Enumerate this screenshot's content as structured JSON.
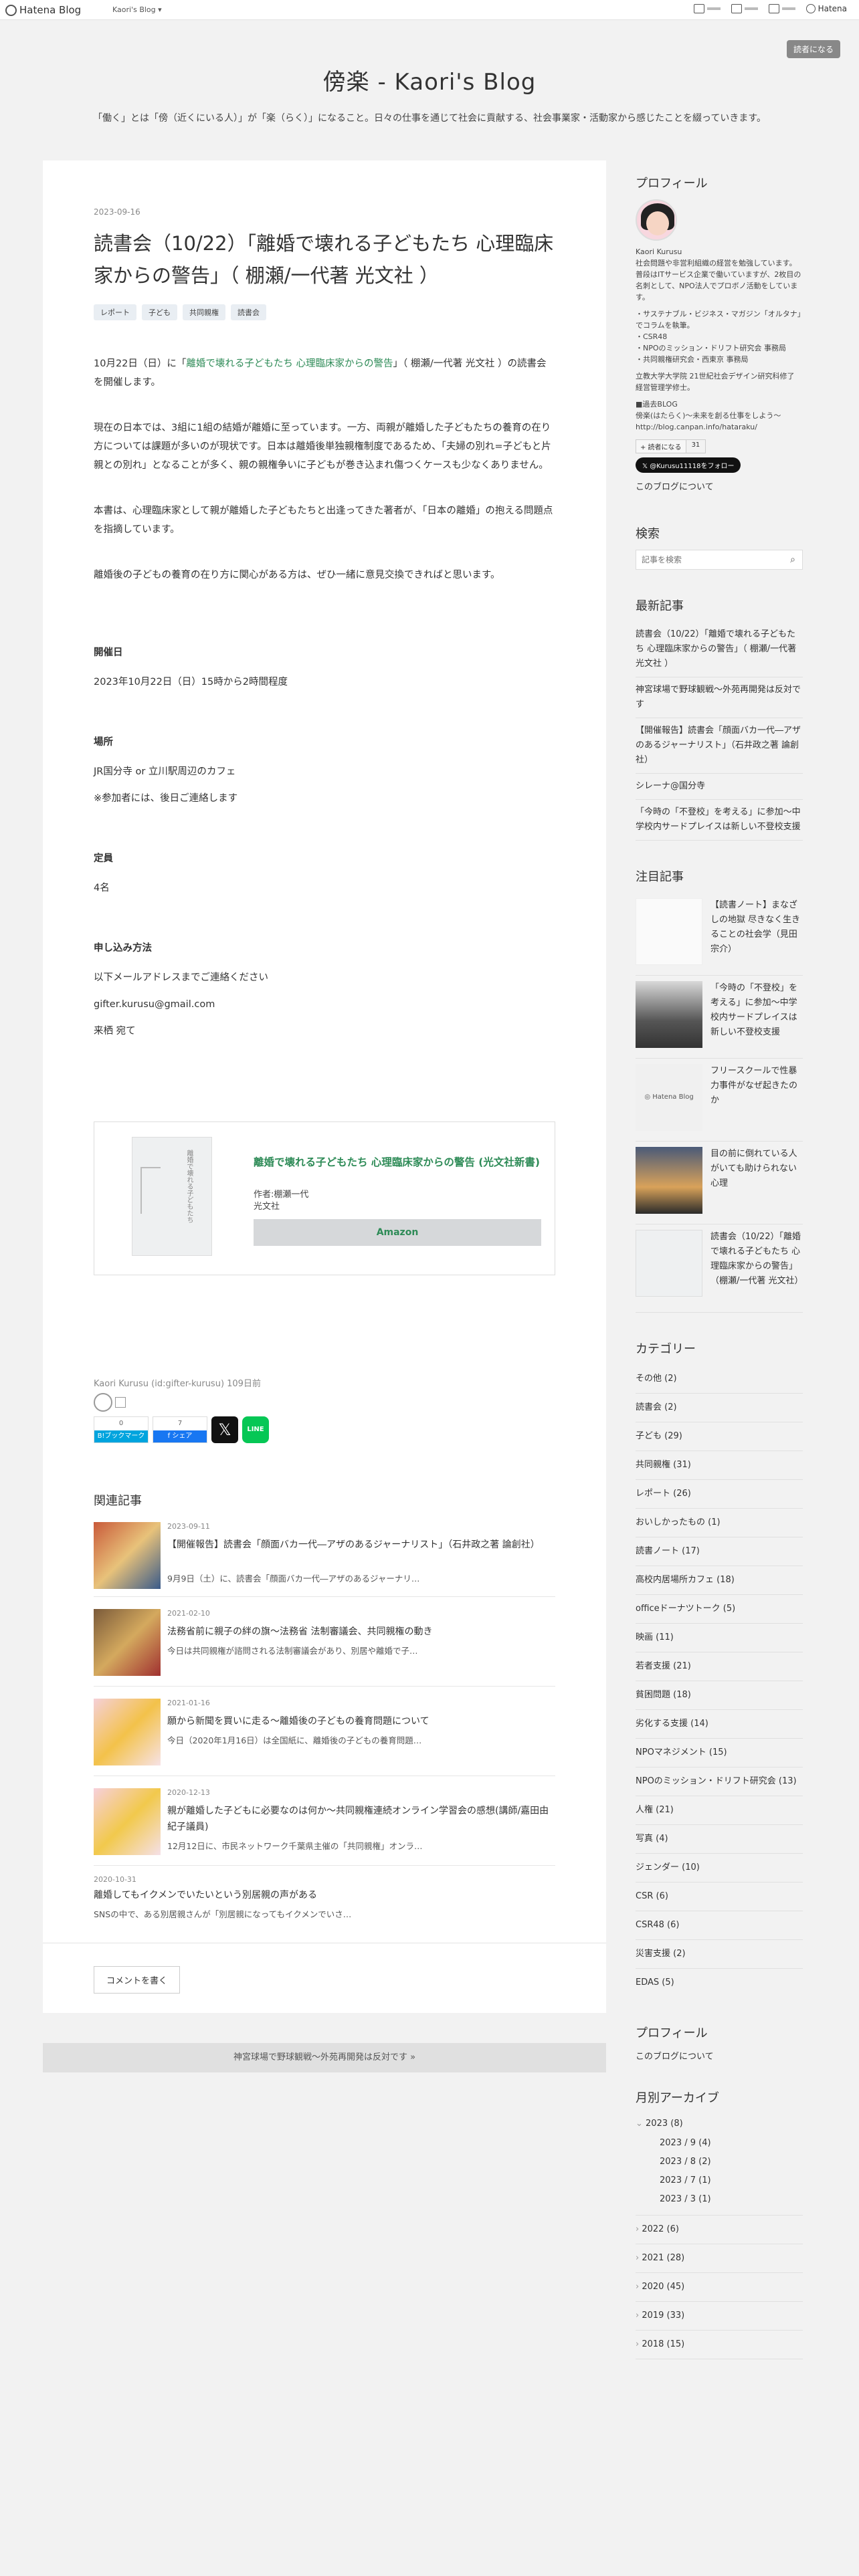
{
  "topbar": {
    "brand": "Hatena Blog",
    "blog_name": "Kaori's Blog ▾",
    "tool1": "▭",
    "tool2": "≡",
    "tool3": "▤",
    "user": "Hatena"
  },
  "reader_button": "読者になる",
  "header": {
    "title": "傍楽 - Kaori's Blog",
    "tagline": "「働く」とは「傍（近くにいる人）」が「楽（らく）」になること。日々の仕事を通じて社会に貢献する、社会事業家・活動家から感じたことを綴っていきます。"
  },
  "article": {
    "date": "2023-09-16",
    "title": "読書会（10/22）「離婚で壊れる子どもたち 心理臨床家からの警告」（ 棚瀬/一代著 光文社 ）",
    "tags": [
      "レポート",
      "子ども",
      "共同親権",
      "読書会"
    ],
    "p1_a": "10月22日（日）に「",
    "p1_link": "離婚で壊れる子どもたち 心理臨床家からの警告",
    "p1_b": "」（ 棚瀬/一代著 光文社 ）の読書会を開催します。",
    "p2": "現在の日本では、3組に1組の結婚が離婚に至っています。一方、両親が離婚した子どもたちの養育の在り方については課題が多いのが現状です。日本は離婚後単独親権制度であるため、「夫婦の別れ=子どもと片親との別れ」となることが多く、親の親権争いに子どもが巻き込まれ傷つくケースも少なくありません。",
    "p3": "本書は、心理臨床家として親が離婚した子どもたちと出逢ってきた著者が、「日本の離婚」の抱える問題点を指摘しています。",
    "p4": "離婚後の子どもの養育の在り方に関心がある方は、ぜひ一緒に意見交換できればと思います。",
    "h_date": "開催日",
    "date_val": "2023年10月22日（日）15時から2時間程度",
    "h_place": "場所",
    "place_val": "JR国分寺 or 立川駅周辺のカフェ",
    "place_note": "※参加者には、後日ご連絡します",
    "h_cap": "定員",
    "cap_val": "4名",
    "h_apply": "申し込み方法",
    "apply1": "以下メールアドレスまでご連絡ください",
    "apply2": "gifter.kurusu@gmail.com",
    "apply3": "来栖 宛て",
    "amazon": {
      "title": "離婚で壊れる子どもたち 心理臨床家からの警告 (光文社新書)",
      "author": "作者:棚瀬一代",
      "publisher": "光文社",
      "button": "Amazon",
      "cover_text": "離婚で壊れる子どもたち"
    },
    "author_line": "Kaori Kurusu (id:gifter-kurusu) 109日前",
    "hatebu_count": "0",
    "hatebu_label": "B!ブックマーク",
    "fb_count": "7",
    "fb_label": "f シェア",
    "x_label": "𝕏",
    "line_label": "LINE",
    "related_title": "関連記事",
    "related": [
      {
        "date": "2023-09-11",
        "title": "【開催報告】読書会「顔面バカ一代―アザのあるジャーナリスト」（石井政之著 論創社）",
        "snippet": "9月9日（土）に、読書会「顔面バカ一代―アザのあるジャーナリ…"
      },
      {
        "date": "2021-02-10",
        "title": "法務省前に親子の絆の旗〜法務省 法制審議会、共同親権の動き",
        "snippet": "今日は共同親権が諮問される法制審議会があり、別居や離婚で子…"
      },
      {
        "date": "2021-01-16",
        "title": "願から新聞を買いに走る〜離婚後の子どもの養育問題について",
        "snippet": "今日（2020年1月16日）は全国紙に、離婚後の子どもの養育問題…"
      },
      {
        "date": "2020-12-13",
        "title": "親が離婚した子どもに必要なのは何か〜共同親権連続オンライン学習会の感想(講師/嘉田由紀子議員)",
        "snippet": "12月12日に、市民ネットワーク千葉県主催の「共同親権」オンラ…"
      },
      {
        "date": "2020-10-31",
        "title": "離婚してもイクメンでいたいという別居親の声がある",
        "snippet": "SNSの中で、ある別居親さんが「別居親になってもイクメンでいさ…"
      }
    ],
    "comment_button": "コメントを書く"
  },
  "pager": "神宮球場で野球観戦〜外苑再開発は反対です »",
  "sidebar": {
    "profile_title": "プロフィール",
    "profile_name": "Kaori Kurusu",
    "profile_lines": [
      "社会問題や非営利組織の経営を勉強しています。普段はITサービス企業で働いていますが、2枚目の名刺として、NPO法人でプロボノ活動をしています。",
      "",
      "・サステナブル・ビジネス・マガジン「オルタナ」でコラムを執筆。",
      "・CSR48",
      "・NPOのミッション・ドリフト研究会 事務局",
      "・共同親権研究会・西東京 事務局",
      "",
      "立教大学大学院 21世紀社会デザイン研究科修了 経営管理学修士。",
      "",
      "■過去BLOG",
      "傍楽(はたらく)〜未来を創る仕事をしよう〜",
      "http://blog.canpan.info/hataraku/"
    ],
    "reader_count": "31",
    "reader_label": "+ 読者になる",
    "follow_label": "𝕏 @Kurusu11118をフォロー",
    "about_link": "このブログについて",
    "search_title": "検索",
    "search_placeholder": "記事を検索",
    "recent_title": "最新記事",
    "recent": [
      "読書会（10/22）「離婚で壊れる子どもたち 心理臨床家からの警告」（ 棚瀬/一代著 光文社 ）",
      "神宮球場で野球観戦〜外苑再開発は反対です",
      "【開催報告】読書会「顔面バカ一代―アザのあるジャーナリスト」（石井政之著 論創社）",
      "シレーナ@国分寺",
      "「今時の「不登校」を考える」に参加〜中学校内サードプレイスは新しい不登校支援"
    ],
    "featured_title": "注目記事",
    "featured": [
      "【読書ノート】まなざしの地獄 尽きなく生きることの社会学（見田宗介）",
      "「今時の「不登校」を考える」に参加〜中学校内サードプレイスは新しい不登校支援",
      "フリースクールで性暴力事件がなぜ起きたのか",
      "目の前に倒れている人がいても助けられない心理",
      "読書会（10/22）「離婚で壊れる子どもたち 心理臨床家からの警告」（棚瀬/一代著 光文社）"
    ],
    "category_title": "カテゴリー",
    "categories": [
      "その他 (2)",
      "読書会 (2)",
      "子ども (29)",
      "共同親権 (31)",
      "レポート (26)",
      "おいしかったもの (1)",
      "読書ノート (17)",
      "高校内居場所カフェ (18)",
      "officeドーナツトーク (5)",
      "映画 (11)",
      "若者支援 (21)",
      "貧困問題 (18)",
      "劣化する支援 (14)",
      "NPOマネジメント (15)",
      "NPOのミッション・ドリフト研究会 (13)",
      "人権 (21)",
      "写真 (4)",
      "ジェンダー (10)",
      "CSR (6)",
      "CSR48 (6)",
      "災害支援 (2)",
      "EDAS (5)"
    ],
    "profile2_title": "プロフィール",
    "profile2_link": "このブログについて",
    "archive_title": "月別アーカイブ",
    "archive_open": "2023 (8)",
    "archive_months": [
      "2023 / 9 (4)",
      "2023 / 8 (2)",
      "2023 / 7 (1)",
      "2023 / 3 (1)"
    ],
    "archive_years": [
      "2022 (6)",
      "2021 (28)",
      "2020 (45)",
      "2019 (33)",
      "2018 (15)"
    ]
  }
}
